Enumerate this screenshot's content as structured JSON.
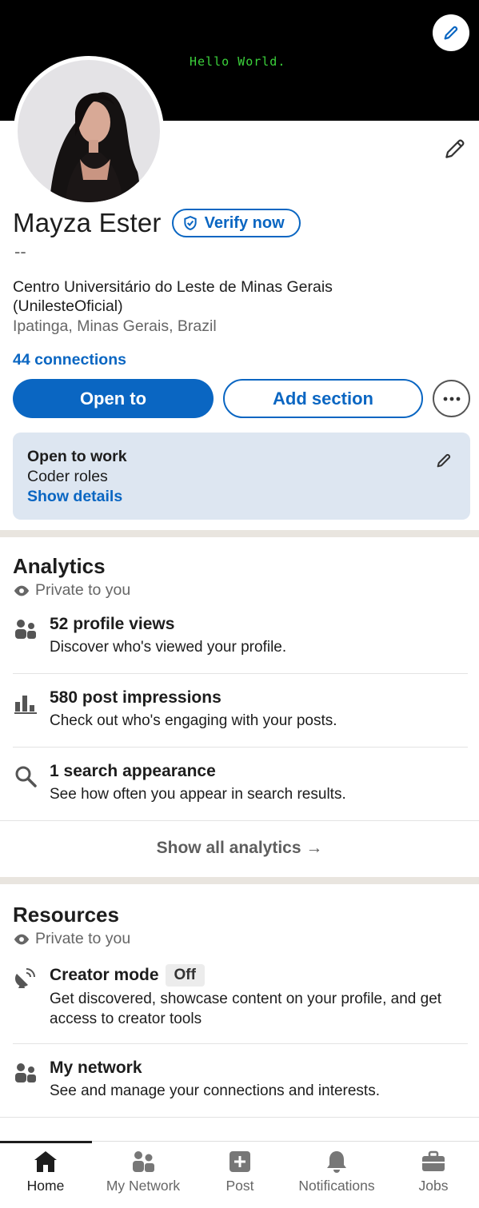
{
  "banner": {
    "text": "Hello World."
  },
  "profile": {
    "name": "Mayza Ester",
    "verify_label": "Verify now",
    "headline": "--",
    "education": "Centro Universitário do Leste de Minas Gerais (UnilesteOficial)",
    "location": "Ipatinga, Minas Gerais, Brazil",
    "connections": "44 connections"
  },
  "actions": {
    "open_to": "Open to",
    "add_section": "Add section"
  },
  "open_to_work": {
    "title": "Open to work",
    "roles": "Coder roles",
    "link": "Show details"
  },
  "analytics": {
    "title": "Analytics",
    "privacy": "Private to you",
    "items": [
      {
        "title": "52 profile views",
        "subtitle": "Discover who's viewed your profile.",
        "icon": "people-icon"
      },
      {
        "title": "580 post impressions",
        "subtitle": "Check out who's engaging with your posts.",
        "icon": "bar-chart-icon"
      },
      {
        "title": "1 search appearance",
        "subtitle": "See how often you appear in search results.",
        "icon": "search-icon"
      }
    ],
    "show_all": "Show all analytics →"
  },
  "resources": {
    "title": "Resources",
    "privacy": "Private to you",
    "items": [
      {
        "title": "Creator mode",
        "badge": "Off",
        "subtitle": "Get discovered, showcase content on your profile, and get access to creator tools",
        "icon": "satellite-dish-icon"
      },
      {
        "title": "My network",
        "subtitle": "See and manage your connections and interests.",
        "icon": "people-icon"
      }
    ]
  },
  "nav": {
    "items": [
      {
        "label": "Home",
        "icon": "home-icon",
        "active": true
      },
      {
        "label": "My Network",
        "icon": "network-icon"
      },
      {
        "label": "Post",
        "icon": "plus-square-icon"
      },
      {
        "label": "Notifications",
        "icon": "bell-icon"
      },
      {
        "label": "Jobs",
        "icon": "briefcase-icon"
      }
    ]
  },
  "colors": {
    "accent": "#0a66c2",
    "banner": "#000000",
    "banner_text": "#3bd13b",
    "open_to_work_bg": "#dde6f1"
  }
}
